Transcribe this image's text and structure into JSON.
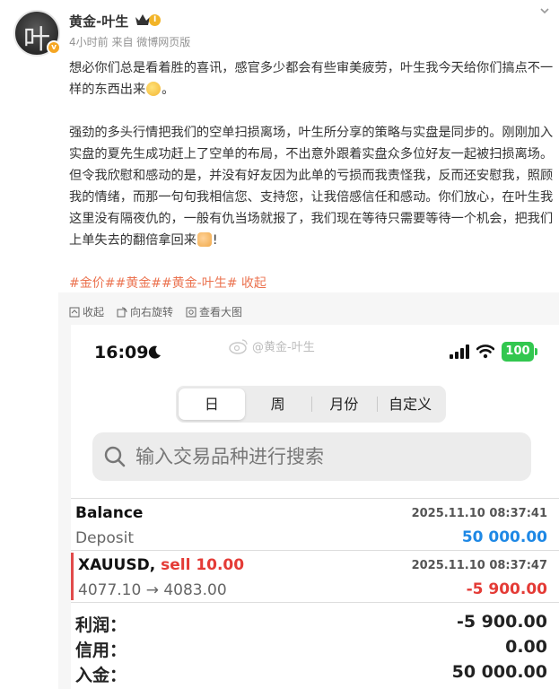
{
  "author": {
    "name": "黄金-叶生",
    "level": "Ⅰ",
    "time": "4小时前",
    "source": "来自 微博网页版",
    "avatar_char": "叶"
  },
  "post": {
    "para1": "想必你们总是看着胜的喜讯，感官多少都会有些审美疲劳，叶生我今天给你们搞点不一样的东西出来",
    "para2": "强劲的多头行情把我们的空单扫损离场，叶生所分享的策略与实盘是同步的。刚刚加入实盘的夏先生成功赶上了空单的布局，不出意外跟着实盘众多位好友一起被扫损离场。但令我欣慰和感动的是，并没有好友因为此单的亏损而我责怪我，反而还安慰我，照顾我的情绪，而那一句句我相信您、支持您，让我倍感信任和感动。你们放心，在叶生我这里没有隔夜仇的，一般有仇当场就报了，我们现在等待只需要等待一个机会，把我们上单失去的翻倍拿回来",
    "para2_end": "!",
    "tags": [
      "#金价#",
      "#黄金#",
      "#黄金-叶生#"
    ],
    "collapse": "收起"
  },
  "image_tools": {
    "collapse": "收起",
    "rotate": "向右旋转",
    "view_large": "查看大图"
  },
  "screenshot": {
    "time": "16:09",
    "watermark": "@黄金-叶生",
    "battery": "100",
    "tabs": [
      "日",
      "周",
      "月份",
      "自定义"
    ],
    "search_placeholder": "输入交易品种进行搜索",
    "rows": [
      {
        "title": "Balance",
        "sub": "Deposit",
        "datetime": "2025.11.10 08:37:41",
        "amount": "50 000.00",
        "amount_color": "#1e88e5"
      },
      {
        "symbol": "XAUUSD, ",
        "side": "sell 10.00",
        "sub": "4077.10 → 4083.00",
        "datetime": "2025.11.10 08:37:47",
        "amount": "-5 900.00",
        "amount_color": "#e43b36"
      }
    ],
    "summary": [
      {
        "label": "利润：",
        "value": "-5 900.00"
      },
      {
        "label": "信用：",
        "value": "0.00"
      },
      {
        "label": "入金：",
        "value": "50 000.00"
      }
    ]
  },
  "colors": {
    "tag": "#eb7350",
    "profit_negative": "#e43b36",
    "deposit_blue": "#1e88e5",
    "battery_green": "#32c74f"
  }
}
